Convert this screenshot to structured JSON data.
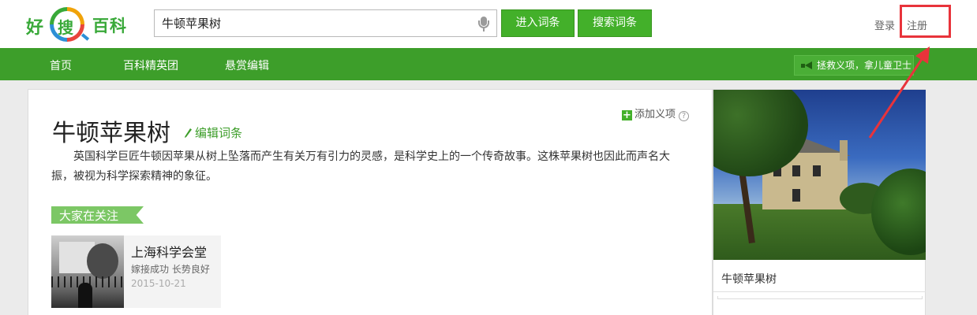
{
  "header": {
    "logo": {
      "hao": "好",
      "sou": "搜",
      "baike": "百科"
    },
    "search": {
      "value": "牛顿苹果树",
      "placeholder": ""
    },
    "enter_entry_label": "进入词条",
    "search_entry_label": "搜索词条",
    "login_label": "登录",
    "register_label": "注册"
  },
  "nav": {
    "items": [
      {
        "label": "首页"
      },
      {
        "label": "百科精英团"
      },
      {
        "label": "悬赏编辑"
      }
    ],
    "promo_label": "拯救义项，拿儿童卫士"
  },
  "entry": {
    "add_item_label": "添加义项",
    "help_symbol": "?",
    "title": "牛顿苹果树",
    "edit_label": "编辑词条",
    "summary": "英国科学巨匠牛顿因苹果从树上坠落而产生有关万有引力的灵感，是科学史上的一个传奇故事。这株苹果树也因此而声名大振，被视为科学探索精神的象征。"
  },
  "attention": {
    "section_label": "大家在关注",
    "cards": [
      {
        "title": "上海科学会堂",
        "desc": "嫁接成功 长势良好",
        "date": "2015-10-21"
      }
    ]
  },
  "sidebar": {
    "photo_caption": "牛顿苹果树"
  },
  "colors": {
    "brand_green": "#43b02a",
    "nav_green": "#3d9e2a",
    "annotation_red": "#e8333b"
  },
  "icons": [
    "microphone-icon",
    "megaphone-icon",
    "plus-icon",
    "help-icon",
    "pencil-icon"
  ]
}
